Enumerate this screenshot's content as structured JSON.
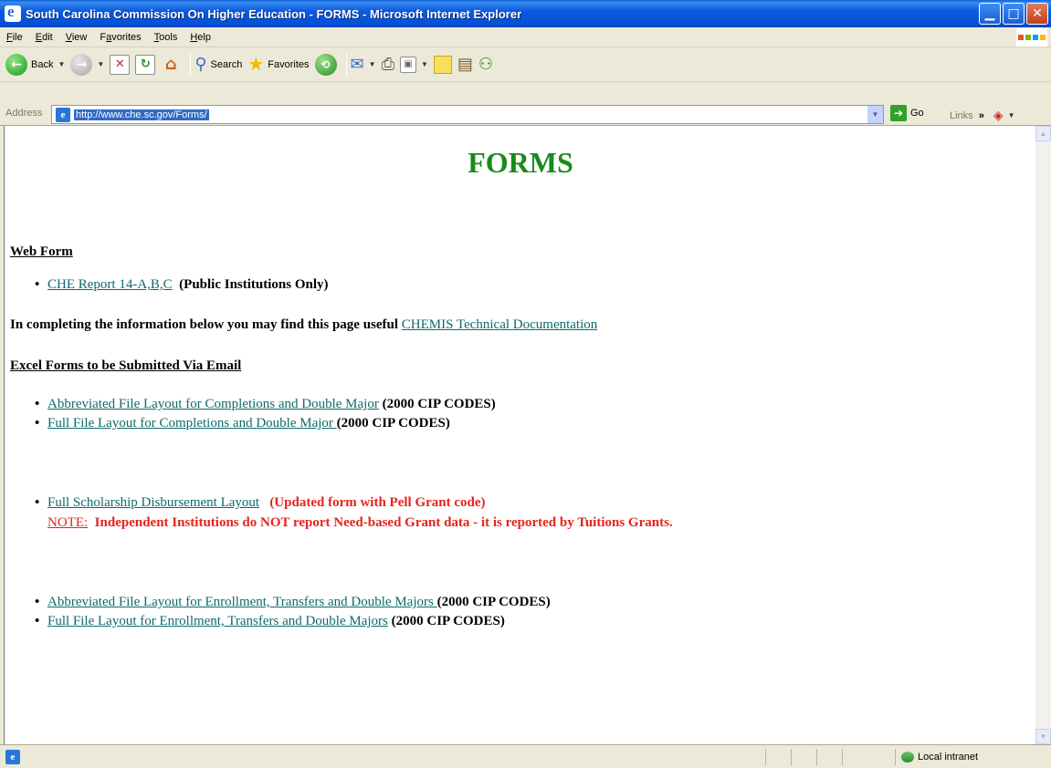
{
  "window": {
    "title": "South Carolina Commission On Higher Education - FORMS - Microsoft Internet Explorer",
    "minimize_icon": "minimize-icon",
    "maximize_icon": "maximize-icon",
    "close_icon": "close-icon"
  },
  "menubar": {
    "items": [
      {
        "pre": "",
        "accel": "F",
        "post": "ile"
      },
      {
        "pre": "",
        "accel": "E",
        "post": "dit"
      },
      {
        "pre": "",
        "accel": "V",
        "post": "iew"
      },
      {
        "pre": "F",
        "accel": "a",
        "post": "vorites"
      },
      {
        "pre": "",
        "accel": "T",
        "post": "ools"
      },
      {
        "pre": "",
        "accel": "H",
        "post": "elp"
      }
    ]
  },
  "toolbar": {
    "back_label": "Back",
    "search_label": "Search",
    "favorites_label": "Favorites"
  },
  "address": {
    "label": "Address",
    "url": "http://www.che.sc.gov/Forms/",
    "go_label": "Go",
    "links_label": "Links"
  },
  "page": {
    "title": "FORMS",
    "web_form_heading": "Web Form",
    "che_report_link": "CHE Report 14-A,B,C",
    "che_report_suffix": "  (Public Institutions Only)",
    "info_text": "In completing the information below you may find this page useful ",
    "chemis_link": "CHEMIS Technical Documentation",
    "excel_heading": "Excel Forms to be Submitted Via Email",
    "completions": [
      {
        "link": "Abbreviated File Layout for Completions and Double Major",
        "suffix": " (2000 CIP CODES)"
      },
      {
        "link": "Full File Layout for Completions and Double Major ",
        "suffix": "(2000 CIP CODES)"
      }
    ],
    "scholarship_link": "Full Scholarship Disbursement Layout",
    "scholarship_suffix": "   (Updated form with Pell Grant code)",
    "note_label": "NOTE:",
    "note_text": "  Independent Institutions do NOT report Need-based Grant data - it is reported by Tuitions Grants.",
    "enrollment": [
      {
        "link": "Abbreviated File Layout for Enrollment, Transfers and Double Majors ",
        "suffix": "(2000 CIP CODES)"
      },
      {
        "link": "Full File Layout for Enrollment, Transfers and Double Majors",
        "suffix": " (2000 CIP CODES)"
      }
    ]
  },
  "status": {
    "zone": "Local intranet"
  },
  "colors": {
    "title_green": "#1a8a1a",
    "link_teal": "#0f6a6a",
    "note_red": "#e8231b"
  }
}
